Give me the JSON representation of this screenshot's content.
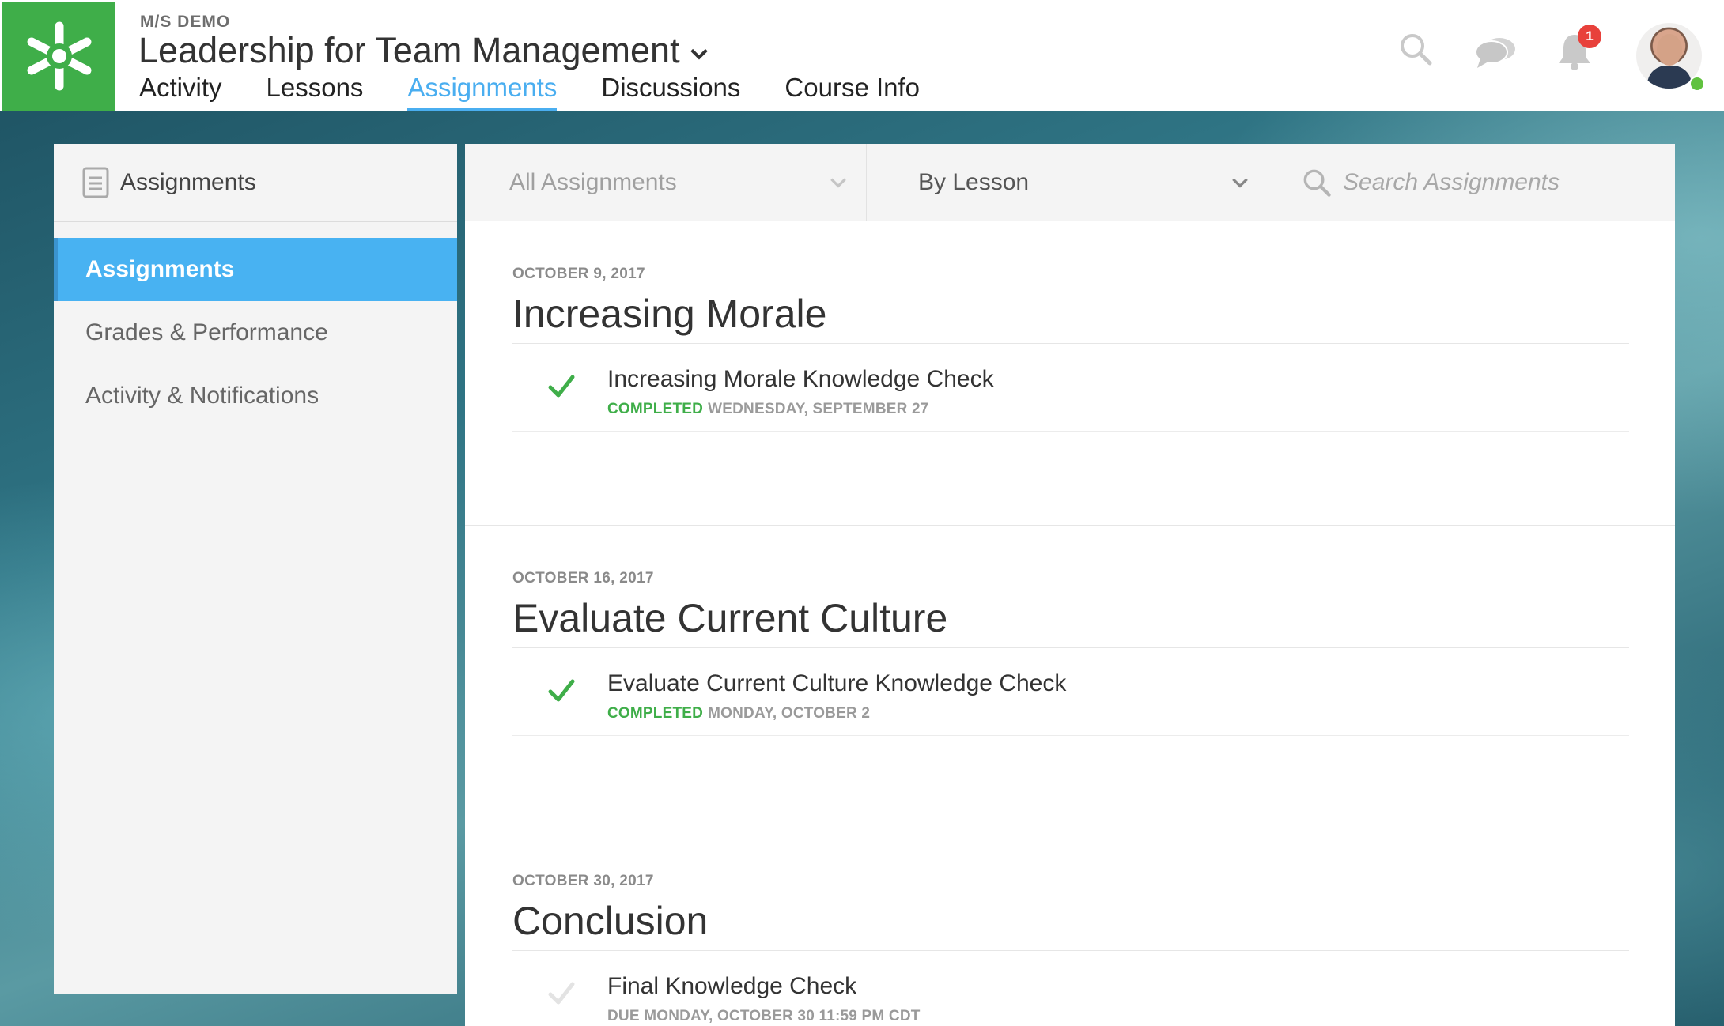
{
  "header": {
    "org": "M/S DEMO",
    "course_title": "Leadership for Team Management",
    "tabs": [
      {
        "label": "Activity",
        "active": false
      },
      {
        "label": "Lessons",
        "active": false
      },
      {
        "label": "Assignments",
        "active": true
      },
      {
        "label": "Discussions",
        "active": false
      },
      {
        "label": "Course Info",
        "active": false
      }
    ],
    "notification_count": "1",
    "icons": [
      "search-icon",
      "chat-icon",
      "bell-icon",
      "avatar"
    ]
  },
  "sidebar": {
    "title": "Assignments",
    "items": [
      {
        "label": "Assignments",
        "active": true
      },
      {
        "label": "Grades & Performance",
        "active": false
      },
      {
        "label": "Activity & Notifications",
        "active": false
      }
    ]
  },
  "filters": {
    "type_filter": "All Assignments",
    "group_filter": "By Lesson",
    "search_placeholder": "Search Assignments"
  },
  "lessons": [
    {
      "date": "OCTOBER 9, 2017",
      "name": "Increasing Morale",
      "items": [
        {
          "title": "Increasing Morale Knowledge Check",
          "status_label": "COMPLETED",
          "status_detail": "WEDNESDAY, SEPTEMBER 27",
          "completed": true
        }
      ]
    },
    {
      "date": "OCTOBER 16, 2017",
      "name": "Evaluate Current Culture",
      "items": [
        {
          "title": "Evaluate Current Culture Knowledge Check",
          "status_label": "COMPLETED",
          "status_detail": "MONDAY, OCTOBER 2",
          "completed": true
        }
      ]
    },
    {
      "date": "OCTOBER 30, 2017",
      "name": "Conclusion",
      "items": [
        {
          "title": "Final Knowledge Check",
          "status_label": "",
          "status_detail": "DUE MONDAY, OCTOBER 30 11:59 PM CDT",
          "completed": false
        }
      ]
    }
  ],
  "colors": {
    "brand_green": "#3fae49",
    "accent_blue": "#4aaef0",
    "badge_red": "#e8413b"
  }
}
